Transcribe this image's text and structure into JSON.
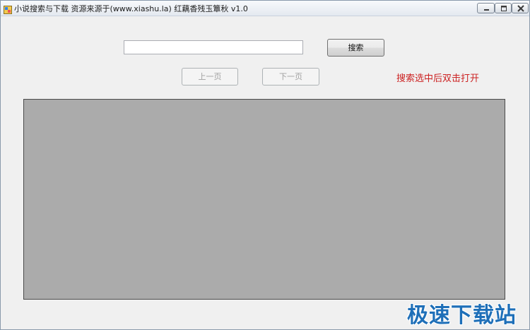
{
  "window": {
    "title": "小说搜索与下载  资源来源于(www.xiashu.la)  红藕香残玉簟秋  v1.0"
  },
  "search": {
    "value": "",
    "placeholder": "",
    "button_label": "搜索"
  },
  "pager": {
    "prev_label": "上一页",
    "next_label": "下一页"
  },
  "hint": "搜索选中后双击打开",
  "results": [],
  "watermark": "极速下载站",
  "colors": {
    "hint": "#cc2222",
    "results_bg": "#ababab",
    "window_bg": "#f0f0f0"
  },
  "icons": {
    "app": "app-icon",
    "minimize": "minimize-icon",
    "maximize": "maximize-icon",
    "close": "close-icon"
  }
}
